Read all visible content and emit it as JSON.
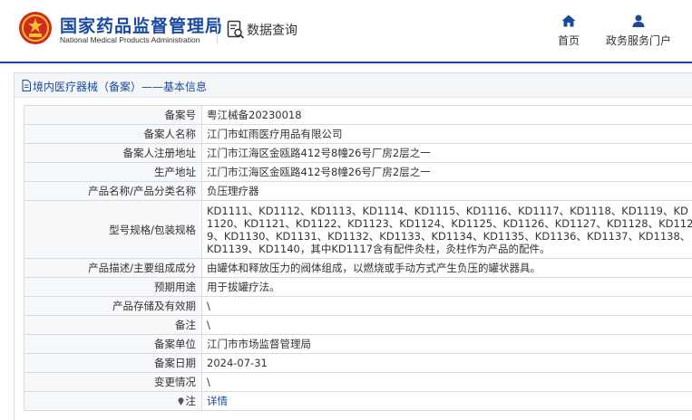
{
  "header": {
    "title_cn": "国家药品监督管理局",
    "title_en": "National Medical Products Administration",
    "query_label": "数据查询",
    "nav": [
      {
        "label": "首页",
        "icon": "home-icon"
      },
      {
        "label": "政务服务门户",
        "icon": "user-icon"
      }
    ]
  },
  "panel": {
    "title": "境内医疗器械（备案）——基本信息"
  },
  "record": {
    "rows": [
      {
        "label": "备案号",
        "value": "粤江械备20230018"
      },
      {
        "label": "备案人名称",
        "value": "江门市虹雨医疗用品有限公司"
      },
      {
        "label": "备案人注册地址",
        "value": "江门市江海区金瓯路412号8幢26号厂房2层之一"
      },
      {
        "label": "生产地址",
        "value": "江门市江海区金瓯路412号8幢26号厂房2层之一"
      },
      {
        "label": "产品名称/产品分类名称",
        "value": "负压理疗器"
      },
      {
        "label": "型号规格/包装规格",
        "value": "KD1111、KD1112、KD1113、KD1114、KD1115、KD1116、KD1117、KD1118、KD1119、KD1120、KD1121、KD1122、KD1123、KD1124、KD1125、KD1126、KD1127、KD1128、KD1129、KD1130、KD1131、KD1132、KD1133、KD1134、KD1135、KD1136、KD1137、KD1138、 KD1139、KD1140，其中KD1117含有配件灸柱，灸柱作为产品的配件。"
      },
      {
        "label": "产品描述/主要组成成分",
        "value": "由罐体和释放压力的阀体组成，以燃烧或手动方式产生负压的罐状器具。"
      },
      {
        "label": "预期用途",
        "value": "用于拔罐疗法。"
      },
      {
        "label": "产品存储及有效期",
        "value": "\\"
      },
      {
        "label": "备注",
        "value": "\\"
      },
      {
        "label": "备案单位",
        "value": "江门市市场监督管理局"
      },
      {
        "label": "备案日期",
        "value": "2024-07-31"
      },
      {
        "label": "变更情况",
        "value": "\\"
      },
      {
        "label": "注",
        "value": "详情"
      }
    ]
  },
  "colors": {
    "brand_blue": "#1a4aa0",
    "logo_red": "#d42a1d",
    "logo_gold": "#f1c232"
  }
}
